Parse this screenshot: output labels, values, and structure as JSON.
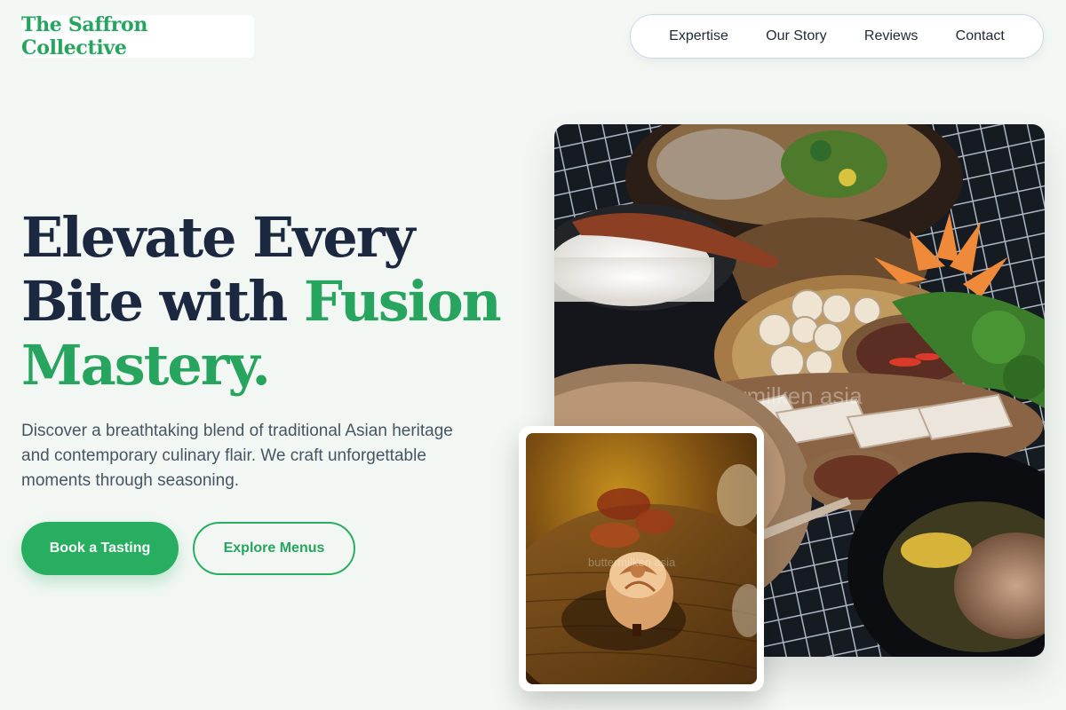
{
  "brand": {
    "name": "The Saffron Collective"
  },
  "nav": {
    "items": [
      {
        "label": "Expertise"
      },
      {
        "label": "Our Story"
      },
      {
        "label": "Reviews"
      },
      {
        "label": "Contact"
      }
    ]
  },
  "hero": {
    "headline_line1": "Elevate Every",
    "headline_line2_plain": "Bite with ",
    "headline_line2_accent": "Fusion",
    "headline_line3_accent": "Mastery.",
    "description": "Discover a breathtaking blend of traditional Asian heritage and contemporary culinary flair. We craft unforgettable moments through seasoning.",
    "primary_button": "Book a Tasting",
    "secondary_button": "Explore Menus"
  },
  "images": {
    "main_watermark": "buttermilken asia",
    "inset_watermark": "buttermilken asia"
  },
  "colors": {
    "accent": "#27ae60",
    "heading": "#1c2740",
    "background": "#f2f7f3"
  }
}
